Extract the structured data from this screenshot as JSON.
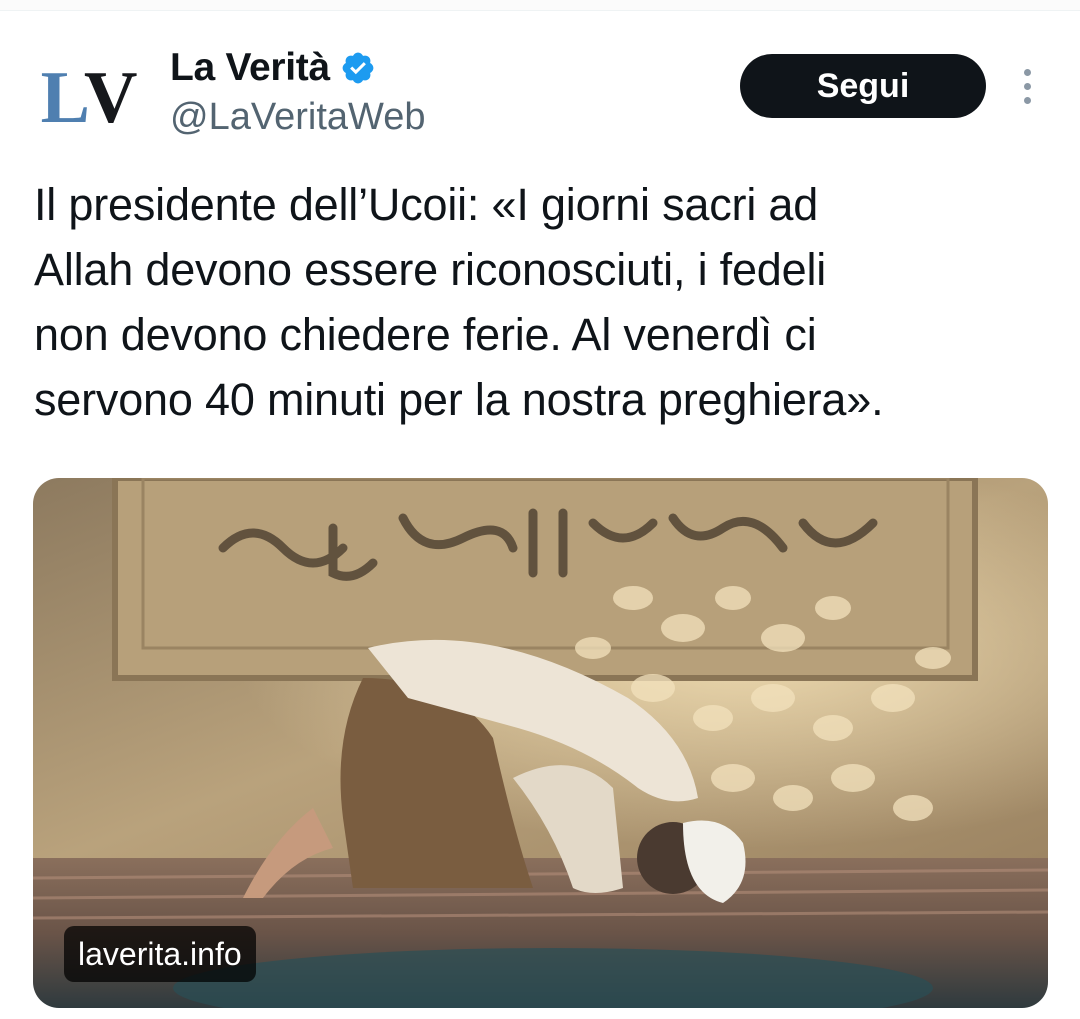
{
  "account": {
    "avatar_letters": {
      "first": "L",
      "second": "V"
    },
    "display_name": "La Verità",
    "handle": "@LaVeritaWeb",
    "verified_icon": "verified-badge-icon",
    "verified_color": "#1d9bf0"
  },
  "actions": {
    "follow_label": "Segui",
    "more_icon": "more-options-icon"
  },
  "tweet": {
    "text_lines": [
      "Il presidente dell’Ucoii: «I giorni sacri ad",
      "Allah devono essere riconosciuti, i fedeli",
      "non devono chiedere ferie. Al venerdì ci",
      "servono 40 minuti per la nostra preghiera»."
    ]
  },
  "media": {
    "domain_label": "laverita.info"
  },
  "colors": {
    "text": "#0f1419",
    "secondary": "#536471",
    "button_bg": "#0f1419",
    "button_text": "#ffffff",
    "logo_blue": "#4f7fb0"
  }
}
